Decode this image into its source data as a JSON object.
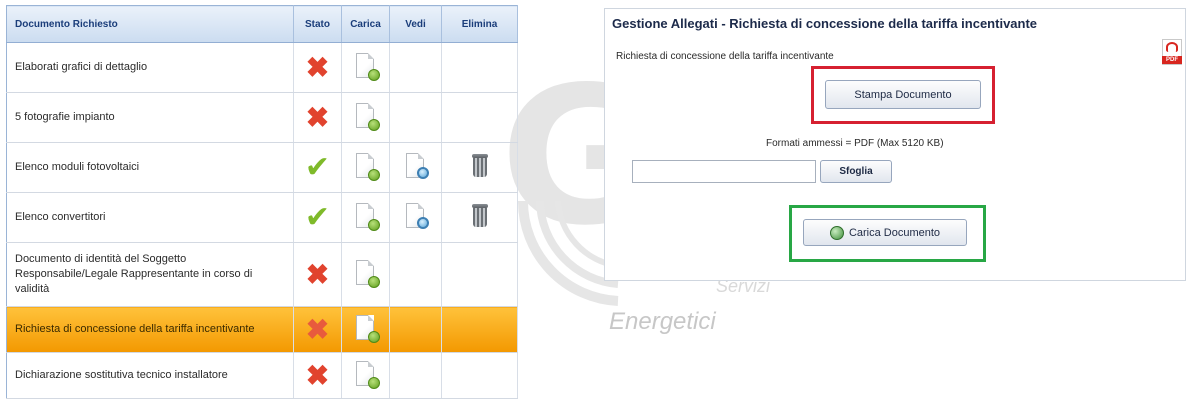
{
  "table": {
    "headers": {
      "documento": "Documento Richiesto",
      "stato": "Stato",
      "carica": "Carica",
      "vedi": "Vedi",
      "elimina": "Elimina"
    },
    "rows": [
      {
        "name": "Elaborati grafici di dettaglio",
        "status": "missing",
        "can_view": false,
        "can_delete": false,
        "selected": false
      },
      {
        "name": "5 fotografie impianto",
        "status": "missing",
        "can_view": false,
        "can_delete": false,
        "selected": false
      },
      {
        "name": "Elenco moduli fotovoltaici",
        "status": "uploaded",
        "can_view": true,
        "can_delete": true,
        "selected": false
      },
      {
        "name": "Elenco convertitori",
        "status": "uploaded",
        "can_view": true,
        "can_delete": true,
        "selected": false
      },
      {
        "name": "Documento di identità del Soggetto Responsabile/Legale Rappresentante in corso di validità",
        "status": "missing",
        "can_view": false,
        "can_delete": false,
        "selected": false
      },
      {
        "name": "Richiesta di concessione della tariffa incentivante",
        "status": "missing",
        "can_view": false,
        "can_delete": false,
        "selected": true
      },
      {
        "name": "Dichiarazione sostitutiva tecnico installatore",
        "status": "missing",
        "can_view": false,
        "can_delete": false,
        "selected": false
      }
    ]
  },
  "watermark": {
    "line1": "Servizi",
    "line2": "Energetici"
  },
  "panel": {
    "title": "Gestione Allegati - Richiesta di concessione della tariffa incentivante",
    "subtitle": "Richiesta di concessione della tariffa incentivante",
    "pdf_icon_label": "PDF",
    "stampa_button": "Stampa Documento",
    "formati": "Formati ammessi = PDF (Max 5120 KB)",
    "file_input_value": "",
    "sfoglia_button": "Sfoglia",
    "carica_button": "Carica Documento"
  },
  "colors": {
    "selected_row": "#f5a000",
    "missing": "#e1432e",
    "uploaded": "#7fba2a",
    "highlight_red": "#d62031",
    "highlight_green": "#28a745"
  },
  "icons": {
    "missing": "x-mark-icon",
    "uploaded": "check-mark-icon",
    "upload": "upload-file-icon",
    "view": "view-file-icon",
    "delete": "trash-icon",
    "pdf": "pdf-icon",
    "upload_globe": "globe-upload-icon"
  }
}
